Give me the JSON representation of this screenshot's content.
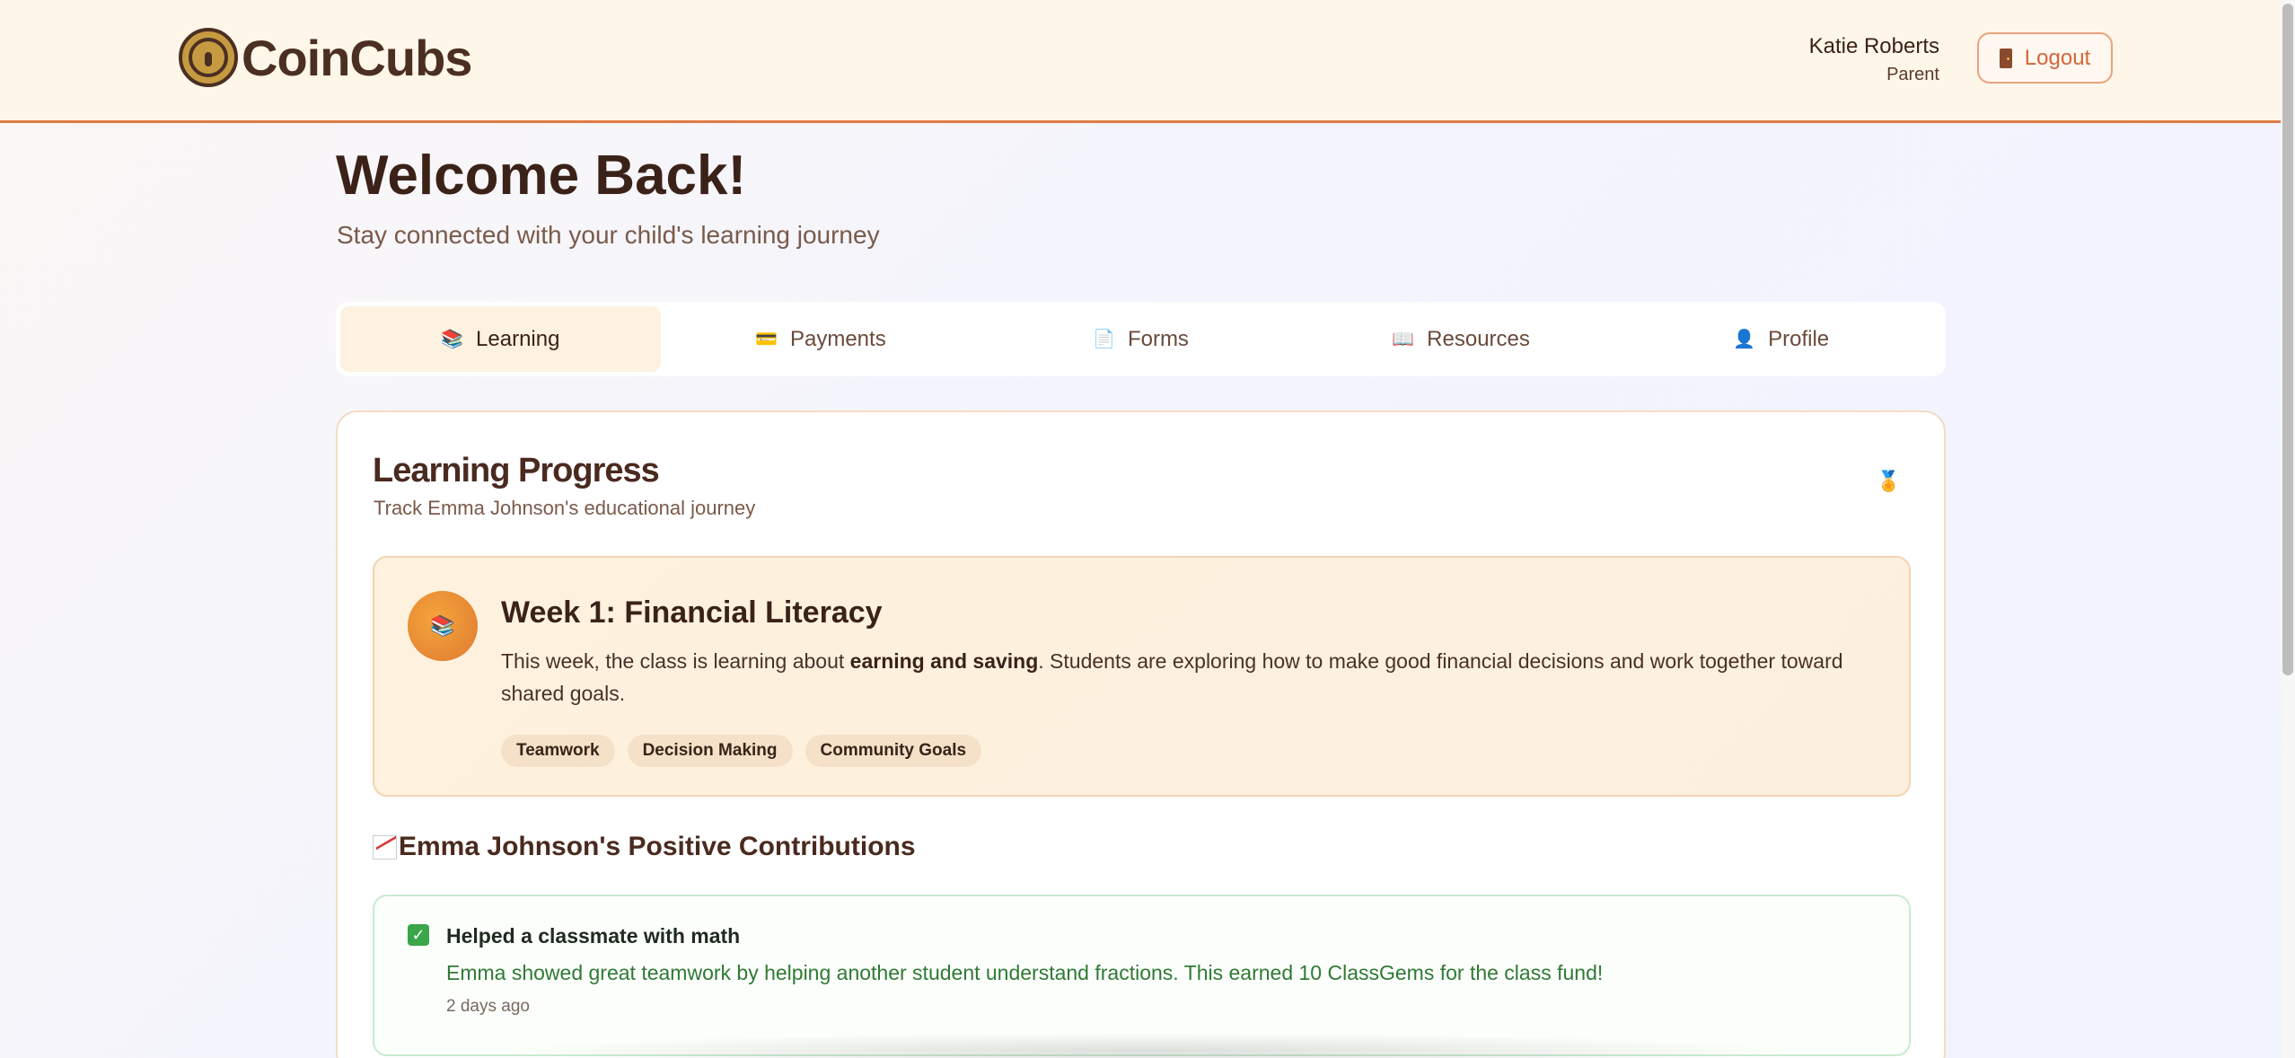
{
  "header": {
    "logo_text": "CoinCubs",
    "user_name": "Katie Roberts",
    "user_role": "Parent",
    "logout_label": "Logout"
  },
  "welcome": {
    "title": "Welcome Back!",
    "subtitle": "Stay connected with your child's learning journey"
  },
  "tabs": [
    {
      "label": "Learning",
      "icon": "📚",
      "active": true
    },
    {
      "label": "Payments",
      "icon": "💳",
      "active": false
    },
    {
      "label": "Forms",
      "icon": "📄",
      "active": false
    },
    {
      "label": "Resources",
      "icon": "📖",
      "active": false
    },
    {
      "label": "Profile",
      "icon": "👤",
      "active": false
    }
  ],
  "learning": {
    "title": "Learning Progress",
    "subtitle": "Track Emma Johnson's educational journey",
    "medal_icon": "🏅",
    "week": {
      "badge_icon": "📚",
      "title": "Week 1: Financial Literacy",
      "desc_before": "This week, the class is learning about ",
      "desc_bold": "earning and saving",
      "desc_after": ". Students are exploring how to make good financial decisions and work together toward shared goals.",
      "tags": [
        "Teamwork",
        "Decision Making",
        "Community Goals"
      ]
    },
    "contributions": {
      "heading": "Emma Johnson's Positive Contributions",
      "items": [
        {
          "title": "Helped a classmate with math",
          "description": "Emma showed great teamwork by helping another student understand fractions. This earned 10 ClassGems for the class fund!",
          "time": "2 days ago"
        }
      ]
    }
  }
}
